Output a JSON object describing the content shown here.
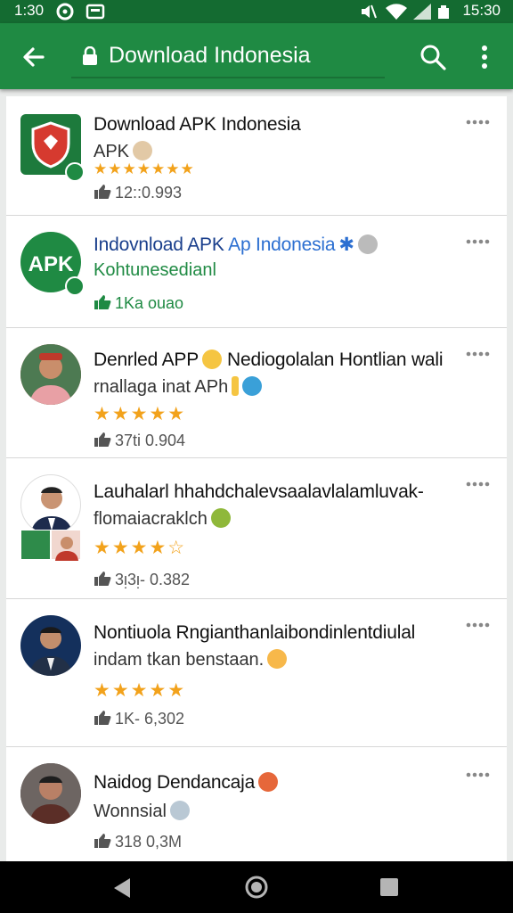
{
  "status_bar": {
    "time_left": "1:30",
    "time_right": "15:30"
  },
  "search": {
    "query": "Download Indonesia"
  },
  "results": [
    {
      "title": "Download APK Indonesia",
      "subtitle": "APK",
      "rating": "★★★★★★★",
      "likes": "12::0.993"
    },
    {
      "title_part1": "Indovnload APK ",
      "title_part2": "Ap Indonesia",
      "subtitle": "Kohtunesedianl",
      "likes": "1Ka ouao"
    },
    {
      "title": "Denrled APP",
      "title_rest": "Nediogolalan Hontlian wali",
      "subtitle": "rnallaga inat APh",
      "rating": "★★★★★",
      "likes": "37ti 0.904"
    },
    {
      "title": "Lauhalarl hhahdchalevsaalavlalamluvak-",
      "subtitle": "flomaiacraklch",
      "rating": "★★★★☆",
      "likes": "3ᴉ3ᴉ- 0.382"
    },
    {
      "title": "Nontiuola Rngianthanlaibondinlentdiulal",
      "subtitle": "indam tkan benstaan.",
      "rating": "★★★★★",
      "likes": "1K- 6,302"
    },
    {
      "title": "Naidog Dendancaja",
      "subtitle": "Wonnsial",
      "likes": "318 0,3M"
    }
  ],
  "colors": {
    "app_bar": "#1f8a43",
    "status_bar": "#146b31",
    "star": "#f2a21b",
    "link": "#1a3f8c"
  }
}
